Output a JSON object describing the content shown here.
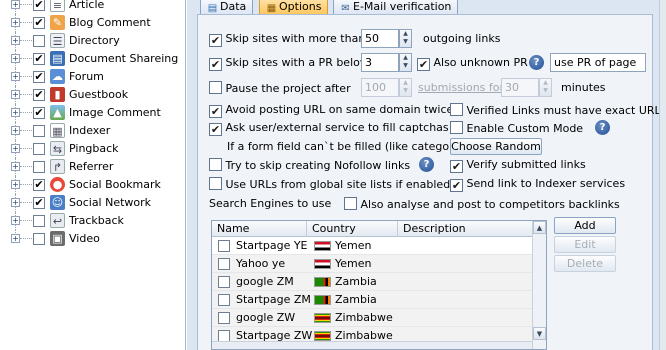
{
  "tree": {
    "items": [
      {
        "label": "Article",
        "checked": true,
        "icon": "article-icon"
      },
      {
        "label": "Blog Comment",
        "checked": true,
        "icon": "blog-comment-icon"
      },
      {
        "label": "Directory",
        "checked": false,
        "icon": "directory-icon"
      },
      {
        "label": "Document Shareing",
        "checked": true,
        "icon": "document-sharing-icon"
      },
      {
        "label": "Forum",
        "checked": true,
        "icon": "forum-icon"
      },
      {
        "label": "Guestbook",
        "checked": true,
        "icon": "guestbook-icon"
      },
      {
        "label": "Image Comment",
        "checked": true,
        "icon": "image-comment-icon"
      },
      {
        "label": "Indexer",
        "checked": false,
        "icon": "indexer-icon"
      },
      {
        "label": "Pingback",
        "checked": false,
        "icon": "pingback-icon"
      },
      {
        "label": "Referrer",
        "checked": false,
        "icon": "referrer-icon"
      },
      {
        "label": "Social Bookmark",
        "checked": true,
        "icon": "social-bookmark-icon"
      },
      {
        "label": "Social Network",
        "checked": true,
        "icon": "social-network-icon"
      },
      {
        "label": "Trackback",
        "checked": false,
        "icon": "trackback-icon"
      },
      {
        "label": "Video",
        "checked": false,
        "icon": "video-icon"
      }
    ]
  },
  "tabs": {
    "data": "Data",
    "options": "Options",
    "email": "E-Mail verification"
  },
  "options": {
    "skip_outgoing_label": "Skip sites with more than",
    "skip_outgoing_value": "50",
    "skip_outgoing_suffix": "outgoing links",
    "skip_pr_label": "Skip sites with a PR below",
    "skip_pr_value": "3",
    "also_unknown_pr": "Also unknown PR",
    "use_pr_of_page": "use PR of page",
    "pause_label": "Pause the project after",
    "pause_value": "100",
    "submissions_for": "submissions for",
    "pause_minutes_value": "30",
    "minutes": "minutes",
    "avoid_posting": "Avoid posting URL on same domain twice",
    "verified_links_exact": "Verified Links must have exact URL",
    "ask_service": "Ask user/external service to fill captchas",
    "enable_custom_mode": "Enable Custom Mode",
    "form_field_text": "If a form field can`t be filled (like category)",
    "choose_random": "Choose Random",
    "skip_nofollow": "Try to skip creating Nofollow links",
    "verify_submitted": "Verify submitted links",
    "use_global_lists": "Use URLs from global site lists if enabled",
    "send_indexer": "Send link to Indexer services",
    "search_engines_label": "Search Engines to use",
    "also_analyse": "Also analyse and post to competitors backlinks"
  },
  "grid": {
    "columns": [
      "Name",
      "Country",
      "Description"
    ],
    "rows": [
      {
        "name": "Startpage YE",
        "country": "Yemen",
        "flag": "yemen"
      },
      {
        "name": "Yahoo ye",
        "country": "Yemen",
        "flag": "yemen"
      },
      {
        "name": "google ZM",
        "country": "Zambia",
        "flag": "zambia"
      },
      {
        "name": "Startpage ZM",
        "country": "Zambia",
        "flag": "zambia"
      },
      {
        "name": "google ZW",
        "country": "Zimbabwe",
        "flag": "zimbabwe"
      },
      {
        "name": "Startpage ZW",
        "country": "Zimbabwe",
        "flag": "zimbabwe"
      }
    ],
    "buttons": {
      "add": "Add",
      "edit": "Edit",
      "delete": "Delete"
    }
  },
  "colors": {
    "accent_tab": "#ffc55a",
    "panel_bg": "#dce6f2",
    "help_icon": "#1f4f98"
  }
}
